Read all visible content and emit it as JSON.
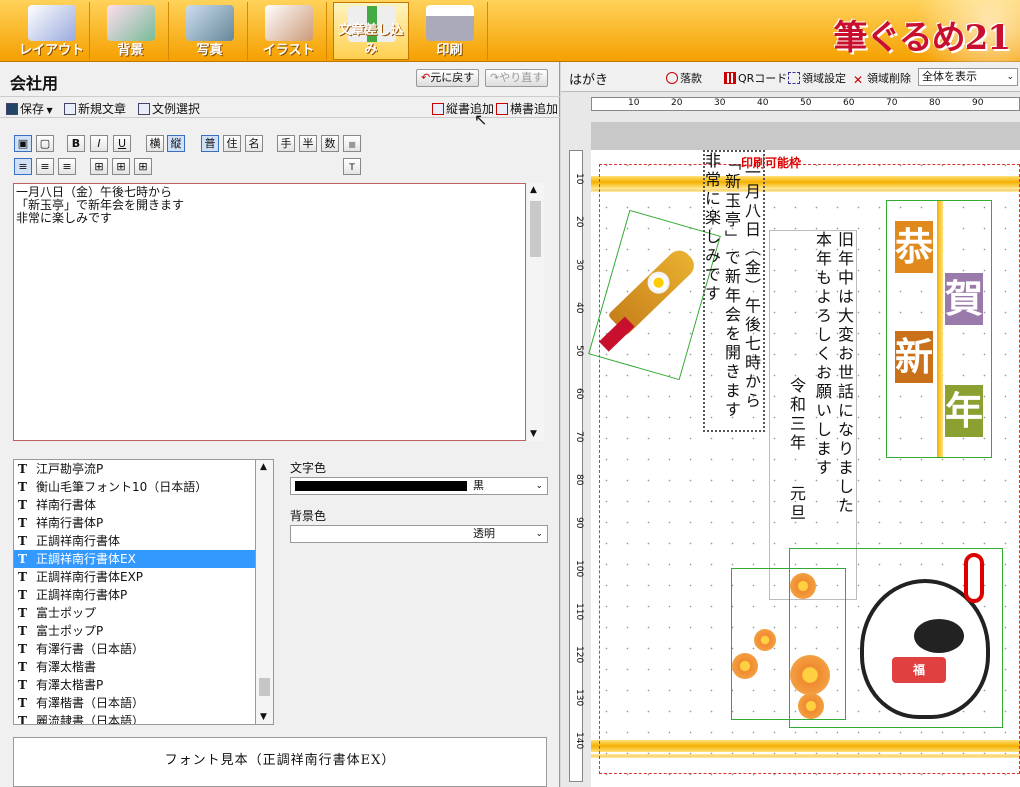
{
  "toolbar": {
    "items": [
      {
        "label": "レイアウト",
        "icon": "layout-icon",
        "color": "#9ad"
      },
      {
        "label": "背景",
        "icon": "background-icon",
        "color": "#7b9"
      },
      {
        "label": "写真",
        "icon": "photo-icon",
        "color": "#689"
      },
      {
        "label": "イラスト",
        "icon": "illustration-icon",
        "color": "#c97"
      },
      {
        "label": "文章差し込み",
        "icon": "text-insert-icon",
        "color": "#9c6"
      },
      {
        "label": "印刷",
        "icon": "printer-icon",
        "color": "#aab"
      }
    ],
    "logo": "筆ぐるめ21"
  },
  "left_panel": {
    "title": "会社用",
    "undo_label": "元に戻す",
    "redo_label": "やり直す",
    "menu": {
      "save": "保存",
      "new_text": "新規文章",
      "select_example": "文例選択",
      "add_vertical": "縦書追加",
      "add_horizontal": "横書追加"
    },
    "format_row1": [
      "B",
      "I",
      "U",
      "横",
      "縦",
      "普",
      "住",
      "名",
      "手",
      "半",
      "数"
    ],
    "text_content": "一月八日（金）午後七時から\n「新玉亭」で新年会を開きます\n非常に楽しみです",
    "fonts": [
      "江戸勘亭流P",
      "衡山毛筆フォント10（日本語）",
      "祥南行書体",
      "祥南行書体P",
      "正調祥南行書体",
      "正調祥南行書体EX",
      "正調祥南行書体EXP",
      "正調祥南行書体P",
      "富士ポップ",
      "富士ポップP",
      "有澤行書（日本語）",
      "有澤太楷書",
      "有澤太楷書P",
      "有澤楷書（日本語）",
      "麗流隷書（日本語）"
    ],
    "selected_font_index": 5,
    "text_color_label": "文字色",
    "text_color_value": "黒",
    "bg_color_label": "背景色",
    "bg_color_value": "透明",
    "preview_text": "フォント見本（正調祥南行書体EX）"
  },
  "right_panel": {
    "title": "はがき",
    "tools": {
      "stamp": "落款",
      "qr": "QRコード",
      "region_setting": "領域設定",
      "region_delete": "領域削除",
      "view_select": "全体を表示"
    },
    "ruler_h": [
      "10",
      "20",
      "30",
      "40",
      "50",
      "60",
      "70",
      "80",
      "90"
    ],
    "ruler_v": [
      "10",
      "20",
      "30",
      "40",
      "50",
      "60",
      "70",
      "80",
      "90",
      "100",
      "110",
      "120",
      "130",
      "140"
    ],
    "print_area_label": "印刷可能枠",
    "greeting_col1": "旧年中は大変お世話になりました",
    "greeting_col2": "本年もよろしくお願いします",
    "date_line1": "令和三年",
    "date_line2": "元旦",
    "inserted_col1": "一月八日（金）午後七時から",
    "inserted_col2": "「新玉亭」で新年会を開きます",
    "inserted_col3": "非常に楽しみです",
    "kanji": [
      "恭",
      "賀",
      "新",
      "年"
    ],
    "charm_text": "福"
  }
}
